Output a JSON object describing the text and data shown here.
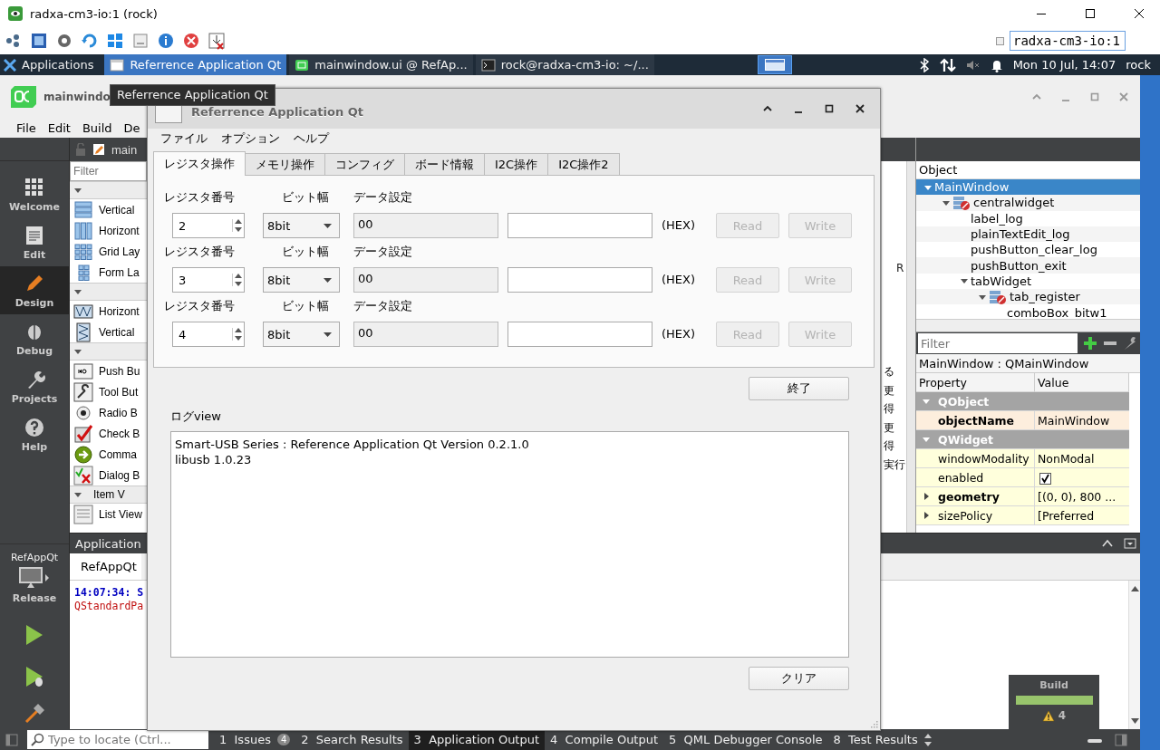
{
  "vnc": {
    "title": "radxa-cm3-io:1 (rock)",
    "display_field": "radxa-cm3-io:1"
  },
  "taskbar": {
    "apps_label": "Applications",
    "tasks": [
      {
        "label": "Referrence Application Qt",
        "selected": true
      },
      {
        "label": "mainwindow.ui @ RefAp...",
        "selected": false
      },
      {
        "label": "rock@radxa-cm3-io: ~/...",
        "selected": false
      }
    ],
    "clock": "Mon 10 Jul, 14:07",
    "user": "rock"
  },
  "tooltip": "Referrence Application Qt",
  "creator": {
    "title": "mainwindo",
    "menu": [
      "File",
      "Edit",
      "Build",
      "De"
    ],
    "modes": [
      {
        "label": "Welcome",
        "selected": false
      },
      {
        "label": "Edit",
        "selected": false
      },
      {
        "label": "Design",
        "selected": true
      },
      {
        "label": "Debug",
        "selected": false
      },
      {
        "label": "Projects",
        "selected": false
      },
      {
        "label": "Help",
        "selected": false
      }
    ],
    "kit": {
      "project": "RefAppQt",
      "build": "Release"
    },
    "file_tab": "main",
    "widget_box": {
      "filter_placeholder": "Filter",
      "items": [
        {
          "kind": "category"
        },
        {
          "kind": "widget",
          "label": "Vertical"
        },
        {
          "kind": "widget",
          "label": "Horizont"
        },
        {
          "kind": "widget",
          "label": "Grid Lay"
        },
        {
          "kind": "widget",
          "label": "Form La"
        },
        {
          "kind": "category"
        },
        {
          "kind": "widget",
          "label": "Horizont"
        },
        {
          "kind": "widget",
          "label": "Vertical"
        },
        {
          "kind": "category"
        },
        {
          "kind": "widget",
          "label": "Push Bu"
        },
        {
          "kind": "widget",
          "label": "Tool But"
        },
        {
          "kind": "widget",
          "label": "Radio B"
        },
        {
          "kind": "widget",
          "label": "Check B"
        },
        {
          "kind": "widget",
          "label": "Comma"
        },
        {
          "kind": "widget",
          "label": "Dialog B"
        },
        {
          "kind": "category",
          "label": "Item V"
        },
        {
          "kind": "widget",
          "label": "List View"
        }
      ]
    },
    "form_edge": {
      "header": "R",
      "lines": [
        "る",
        "更",
        "得",
        "更",
        "得",
        "実行"
      ]
    },
    "object_inspector": {
      "header": "Object",
      "tree": [
        {
          "label": "MainWindow",
          "selected": true,
          "expanded": true,
          "children": [
            {
              "label": "centralwidget",
              "kind": "container",
              "selected": false,
              "expanded": true,
              "children": [
                {
                  "label": "label_log",
                  "selected": false
                },
                {
                  "label": "plainTextEdit_log",
                  "selected": false
                },
                {
                  "label": "pushButton_clear_log",
                  "selected": false
                },
                {
                  "label": "pushButton_exit",
                  "selected": false
                },
                {
                  "label": "tabWidget",
                  "selected": false,
                  "expanded": true,
                  "children": [
                    {
                      "label": "tab_register",
                      "kind": "container",
                      "selected": false,
                      "expanded": true,
                      "children": [
                        {
                          "label": "comboBox_bitw1",
                          "selected": false
                        }
                      ]
                    }
                  ]
                }
              ]
            }
          ]
        }
      ]
    },
    "property_editor": {
      "filter_placeholder": "Filter",
      "object_label": "MainWindow : QMainWindow",
      "columns": [
        "Property",
        "Value"
      ],
      "groups": [
        {
          "name": "QObject",
          "expanded": true,
          "rows": [
            {
              "name": "objectName",
              "value": "MainWindow",
              "modified": true
            }
          ]
        },
        {
          "name": "QWidget",
          "expanded": true,
          "rows": [
            {
              "name": "windowModality",
              "value": "NonModal",
              "modified": false
            },
            {
              "name": "enabled",
              "kind": "checkbox",
              "checked": true,
              "modified": false
            },
            {
              "name": "geometry",
              "value": "[(0, 0), 800 ...",
              "modified": true,
              "expanded": false
            },
            {
              "name": "sizePolicy",
              "value": "[Preferred",
              "modified": false,
              "expanded": false
            }
          ]
        }
      ]
    },
    "output": {
      "title": "Application",
      "tab": "RefAppQt",
      "lines": [
        {
          "kind": "info",
          "text": "14:07:34: S"
        },
        {
          "kind": "error",
          "text": "QStandardPa"
        }
      ]
    },
    "status_bar": {
      "locate_placeholder": "Type to locate (Ctrl...",
      "panes": [
        {
          "number": "1",
          "label": "Issues",
          "badge": "4",
          "selected": false
        },
        {
          "number": "2",
          "label": "Search Results",
          "selected": false
        },
        {
          "number": "3",
          "label": "Application Output",
          "selected": true
        },
        {
          "number": "4",
          "label": "Compile Output",
          "selected": false
        },
        {
          "number": "5",
          "label": "QML Debugger Console",
          "selected": false
        },
        {
          "number": "8",
          "label": "Test Results",
          "selected": false
        }
      ]
    },
    "build_popup": {
      "title": "Build",
      "level": 1,
      "warnings": "4"
    }
  },
  "dialog": {
    "title": "Referrence Application Qt",
    "menu": [
      "ファイル",
      "オプション",
      "ヘルプ"
    ],
    "tabs": [
      {
        "label": "レジスタ操作",
        "selected": true
      },
      {
        "label": "メモリ操作",
        "selected": false
      },
      {
        "label": "コンフィグ",
        "selected": false
      },
      {
        "label": "ボード情報",
        "selected": false
      },
      {
        "label": "I2C操作",
        "selected": false
      },
      {
        "label": "I2C操作2",
        "selected": false
      }
    ],
    "register_rows": [
      {
        "register_label": "レジスタ番号",
        "width_label": "ビット幅",
        "data_label": "データ設定",
        "register": "2",
        "bit_width": "8bit",
        "read_value": "00",
        "hex_label": "(HEX)",
        "read_button": {
          "label": "Read",
          "disabled": true
        },
        "write_button": {
          "label": "Write",
          "disabled": true
        }
      },
      {
        "register_label": "レジスタ番号",
        "width_label": "ビット幅",
        "data_label": "データ設定",
        "register": "3",
        "bit_width": "8bit",
        "read_value": "00",
        "hex_label": "(HEX)",
        "read_button": {
          "label": "Read",
          "disabled": true
        },
        "write_button": {
          "label": "Write",
          "disabled": true
        }
      },
      {
        "register_label": "レジスタ番号",
        "width_label": "ビット幅",
        "data_label": "データ設定",
        "register": "4",
        "bit_width": "8bit",
        "read_value": "00",
        "hex_label": "(HEX)",
        "read_button": {
          "label": "Read",
          "disabled": true
        },
        "write_button": {
          "label": "Write",
          "disabled": true
        }
      }
    ],
    "exit_button": "終了",
    "log_label": "ログview",
    "log_lines": [
      "Smart-USB Series : Reference Application Qt Version 0.2.1.0",
      "libusb 1.0.23"
    ],
    "clear_button": "クリア"
  }
}
